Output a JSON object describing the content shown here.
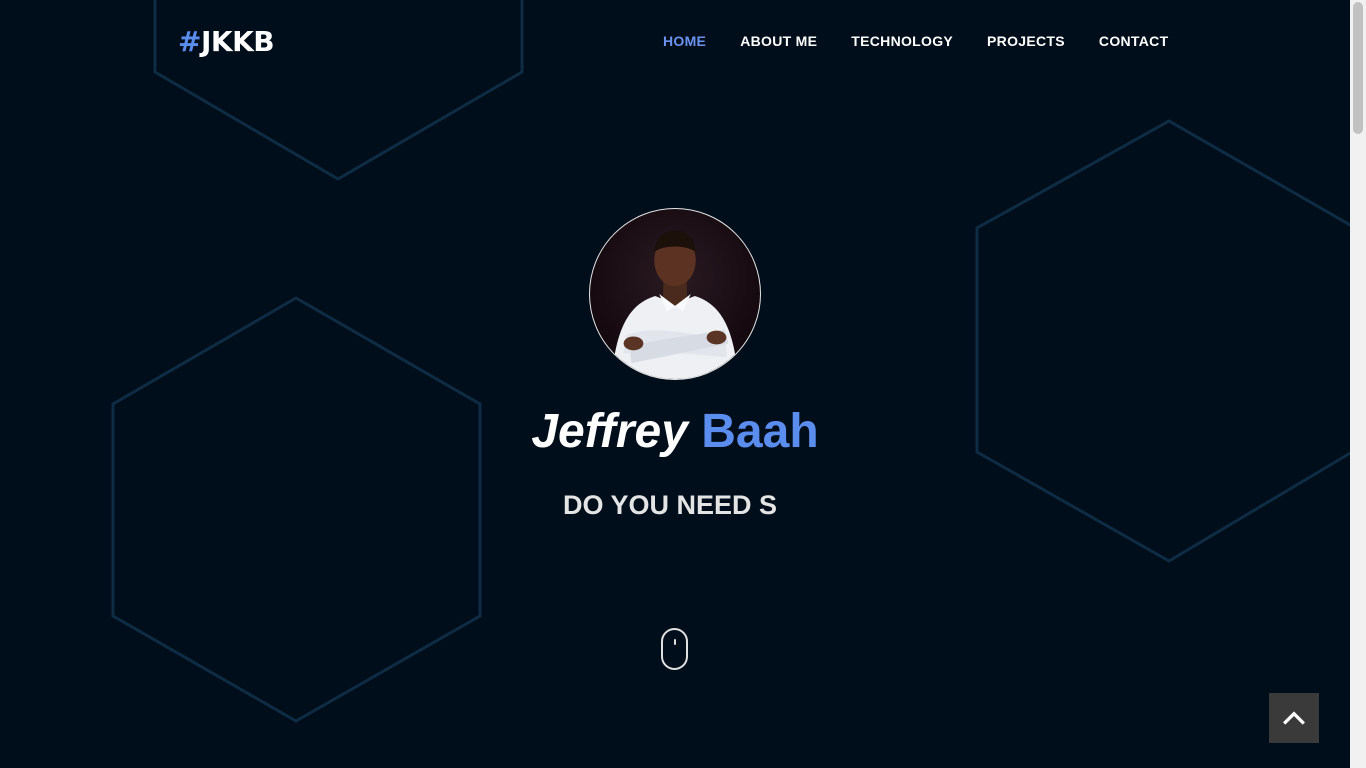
{
  "header": {
    "logo_hash": "#",
    "logo_text": "JKKB",
    "nav": [
      {
        "label": "HOME",
        "active": true
      },
      {
        "label": "ABOUT ME",
        "active": false
      },
      {
        "label": "TECHNOLOGY",
        "active": false
      },
      {
        "label": "PROJECTS",
        "active": false
      },
      {
        "label": "CONTACT",
        "active": false
      }
    ]
  },
  "hero": {
    "first_name": "Jeffrey",
    "last_name": "Baah",
    "tagline": "DO YOU NEED S",
    "avatar_icon": "profile-photo",
    "scroll_icon": "mouse-scroll-icon"
  },
  "controls": {
    "back_to_top_icon": "chevron-up-icon"
  },
  "colors": {
    "background": "#000d1a",
    "accent": "#5b8def",
    "hexagon_stroke": "#0f2c45",
    "back_to_top_bg": "#3a3a3a"
  }
}
